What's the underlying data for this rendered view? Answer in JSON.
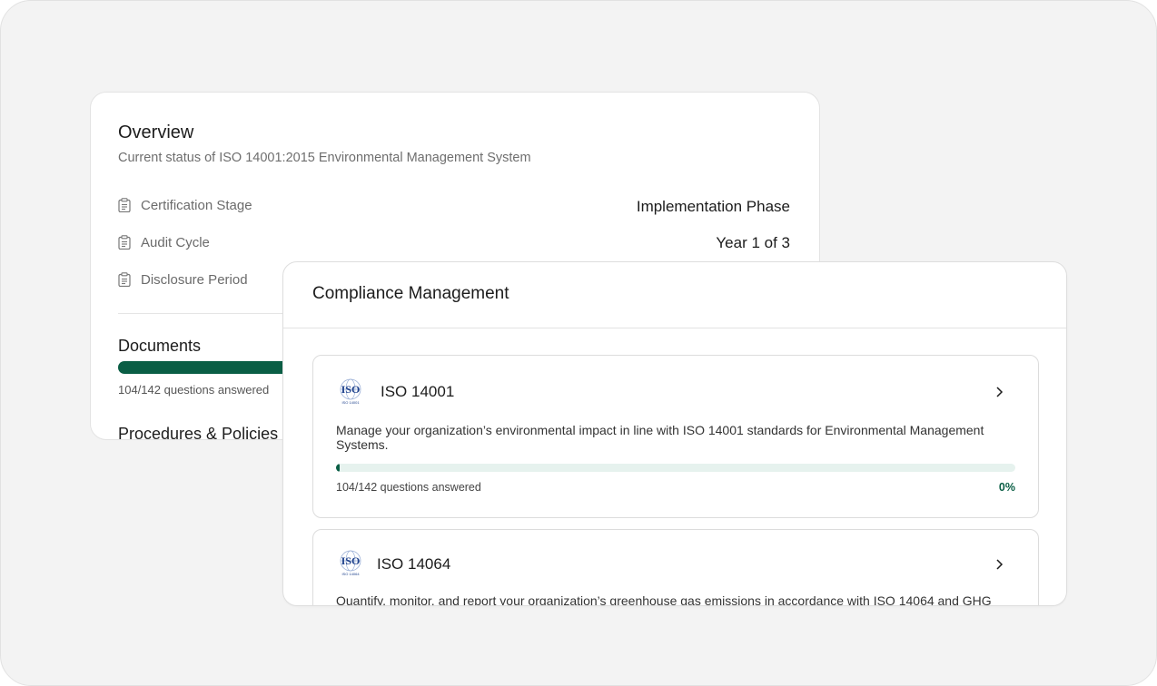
{
  "overview": {
    "title": "Overview",
    "subtitle": "Current status of ISO 14001:2015 Environmental Management System",
    "rows": [
      {
        "label": "Certification Stage",
        "value": "Implementation Phase",
        "icon": "clipboard-icon"
      },
      {
        "label": "Audit Cycle",
        "value": "Year 1 of 3",
        "icon": "clipboard-icon"
      },
      {
        "label": "Disclosure Period",
        "value": "",
        "icon": "clipboard-icon"
      }
    ],
    "documents": {
      "title": "Documents",
      "count": "104/142 questions answered"
    },
    "procedures_title": "Procedures & Policies"
  },
  "compliance": {
    "title": "Compliance Management",
    "standards": [
      {
        "name": "ISO 14001",
        "logo_text": "ISO",
        "logo_subtext": "ISO 14001",
        "description": "Manage your organization’s environmental impact in line with ISO 14001 standards for Environmental Management Systems.",
        "count": "104/142 questions answered",
        "percent": "0%",
        "progress_fraction": 0.005
      },
      {
        "name": "ISO 14064",
        "logo_text": "ISO",
        "logo_subtext": "ISO 14064",
        "description": "Quantify, monitor, and report your organization’s greenhouse gas emissions in accordance with ISO 14064 and GHG"
      }
    ]
  },
  "colors": {
    "accent": "#0a5e45",
    "progress_track": "#e6f2ee",
    "frame_bg": "#f3f3f3",
    "iso_blue": "#1b3f8b"
  }
}
